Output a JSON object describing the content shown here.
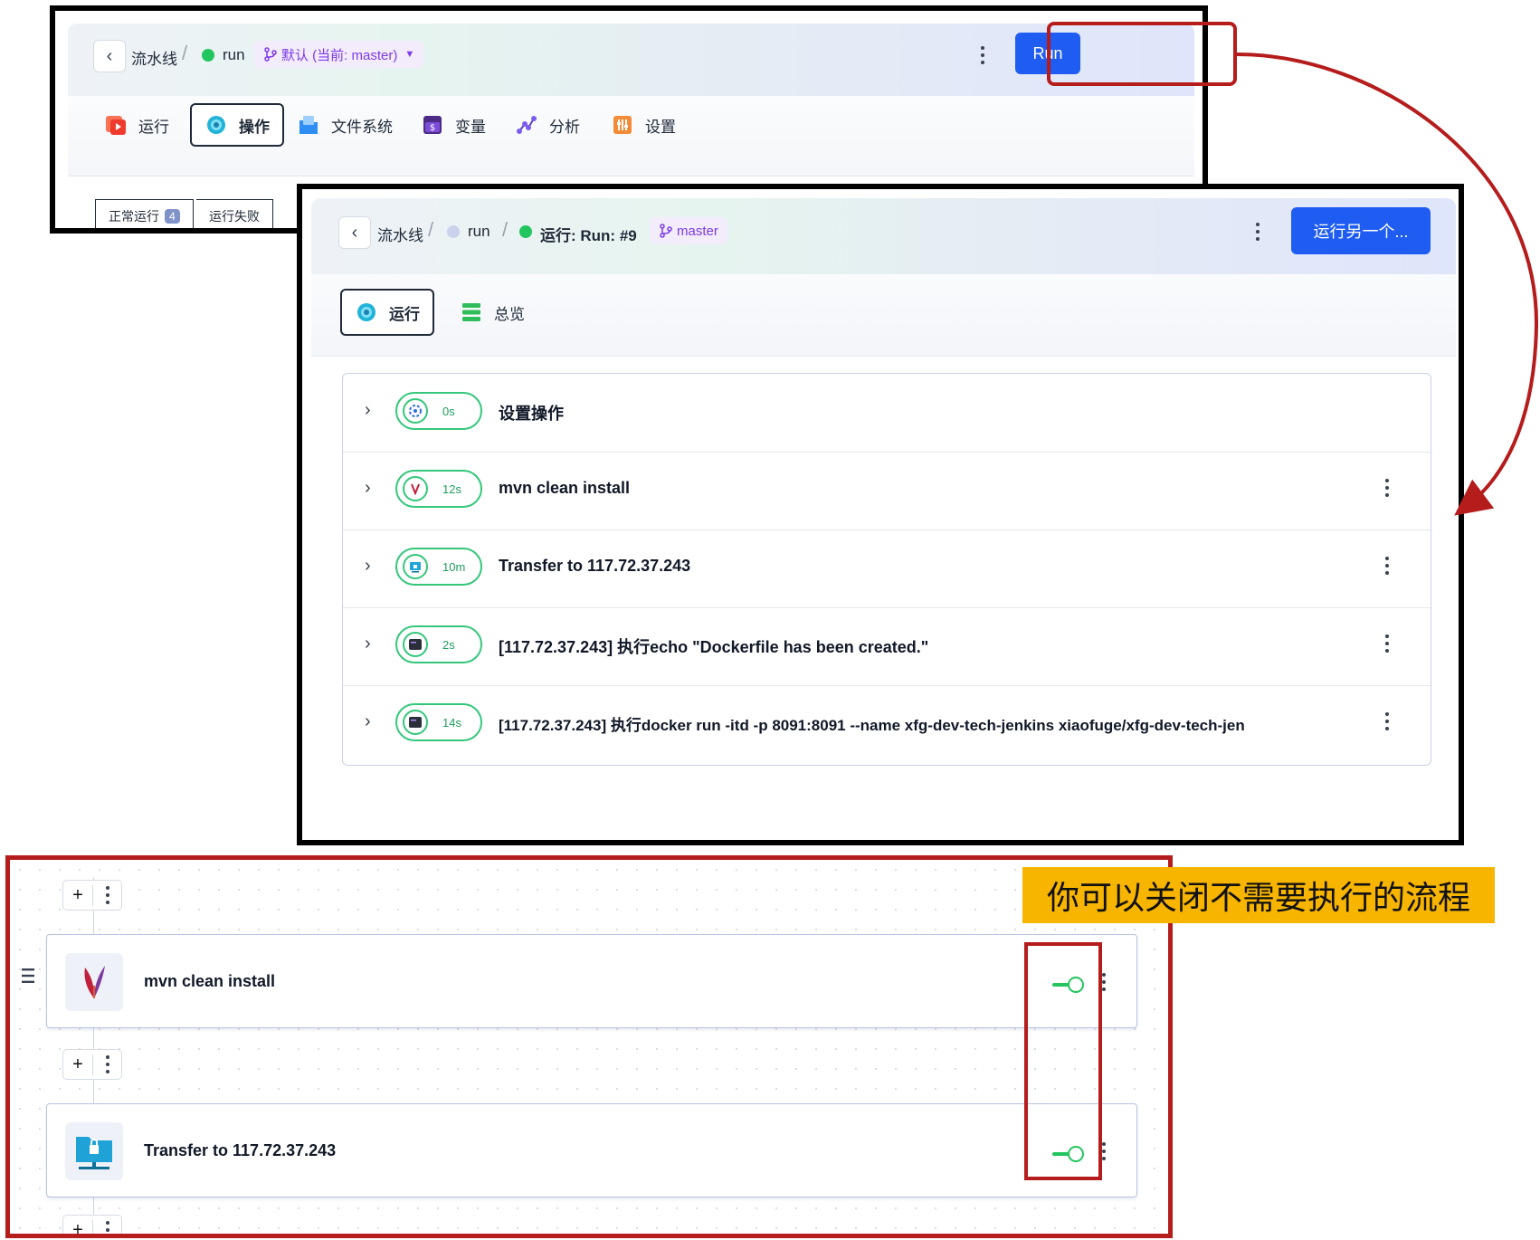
{
  "panel1": {
    "breadcrumb": {
      "pipeline": "流水线",
      "sep": "/",
      "current": "run"
    },
    "branch_label": "默认 (当前: master)",
    "run_button": "Run",
    "tabs": [
      {
        "label": "运行",
        "icon": "run-icon"
      },
      {
        "label": "操作",
        "icon": "operations-icon",
        "active": true
      },
      {
        "label": "文件系统",
        "icon": "filesystem-icon"
      },
      {
        "label": "变量",
        "icon": "variables-icon"
      },
      {
        "label": "分析",
        "icon": "analytics-icon"
      },
      {
        "label": "设置",
        "icon": "settings-icon"
      }
    ],
    "subtabs": [
      {
        "label": "正常运行",
        "count": "4"
      },
      {
        "label": "运行失败"
      }
    ]
  },
  "panel2": {
    "breadcrumb": {
      "pipeline": "流水线",
      "sep": "/",
      "run": "run",
      "sep2": "/",
      "current": "运行: Run: #9"
    },
    "branch_label": "master",
    "run_another_button": "运行另一个...",
    "tabs": [
      {
        "label": "运行",
        "icon": "run-icon",
        "active": true
      },
      {
        "label": "总览",
        "icon": "overview-icon"
      }
    ],
    "steps": [
      {
        "duration": "0s",
        "title": "设置操作",
        "icon": "setup-icon",
        "has_menu": false
      },
      {
        "duration": "12s",
        "title": "mvn clean install",
        "icon": "maven-icon",
        "has_menu": true
      },
      {
        "duration": "10m",
        "title": "Transfer to 117.72.37.243",
        "icon": "sftp-icon",
        "has_menu": true
      },
      {
        "duration": "2s",
        "title": "[117.72.37.243] 执行echo \"Dockerfile has been created.\"",
        "icon": "terminal-icon",
        "has_menu": true
      },
      {
        "duration": "14s",
        "title": "[117.72.37.243] 执行docker run -itd -p 8091:8091 --name xfg-dev-tech-jenkins xiaofuge/xfg-dev-tech-jen",
        "icon": "terminal-icon",
        "has_menu": true
      }
    ]
  },
  "panel3": {
    "add_label": "+",
    "nodes": [
      {
        "title": "mvn clean install",
        "icon": "maven-feather-icon",
        "enabled": true
      },
      {
        "title": "Transfer to 117.72.37.243",
        "icon": "sftp-folder-icon",
        "enabled": true
      }
    ]
  },
  "annotation": {
    "callout": "你可以关闭不需要执行的流程"
  },
  "colors": {
    "accent_blue": "#1f5cf2",
    "success_green": "#34c77b",
    "annotation_red": "#b51c1c",
    "callout_yellow": "#f8b500"
  }
}
